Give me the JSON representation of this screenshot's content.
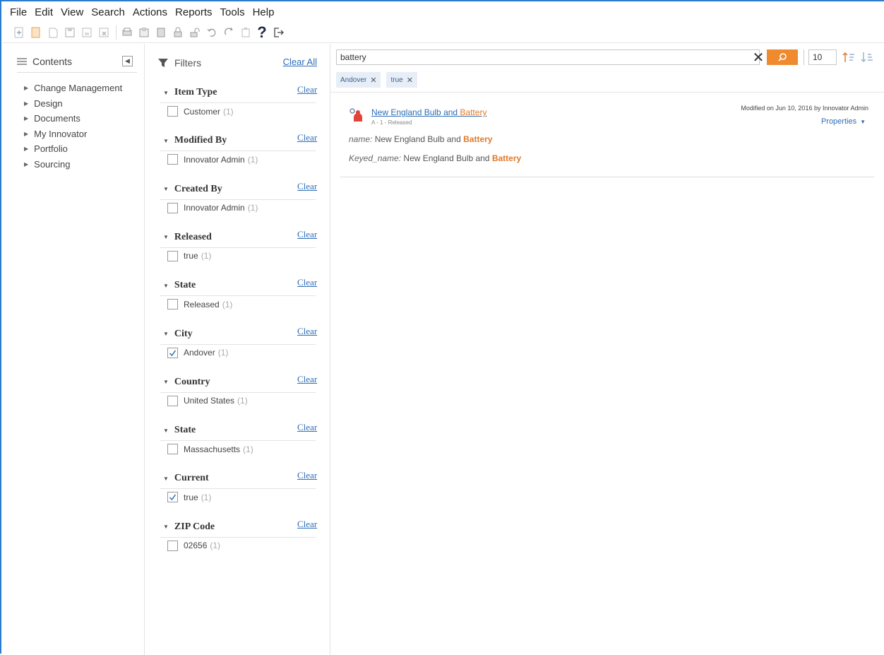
{
  "menu": [
    "File",
    "Edit",
    "View",
    "Search",
    "Actions",
    "Reports",
    "Tools",
    "Help"
  ],
  "toolbar_icons": [
    "new-icon",
    "open-icon",
    "edit-icon",
    "save-icon",
    "save-close-icon",
    "delete-icon",
    "print-icon",
    "copy-icon",
    "paste-icon",
    "lock-icon",
    "unlock-icon",
    "undo-icon",
    "redo-icon",
    "clipboard-icon",
    "help-icon",
    "logout-icon"
  ],
  "toolbar": {
    "help": "?"
  },
  "contents": {
    "title": "Contents",
    "items": [
      "Change Management",
      "Design",
      "Documents",
      "My Innovator",
      "Portfolio",
      "Sourcing"
    ]
  },
  "filters": {
    "title": "Filters",
    "clear_all": "Clear All",
    "clear": "Clear",
    "groups": [
      {
        "title": "Item Type",
        "option": "Customer",
        "count": "(1)",
        "checked": false
      },
      {
        "title": "Modified By",
        "option": "Innovator Admin",
        "count": "(1)",
        "checked": false
      },
      {
        "title": "Created By",
        "option": "Innovator Admin",
        "count": "(1)",
        "checked": false
      },
      {
        "title": "Released",
        "option": "true",
        "count": "(1)",
        "checked": false
      },
      {
        "title": "State",
        "option": "Released",
        "count": "(1)",
        "checked": false
      },
      {
        "title": "City",
        "option": "Andover",
        "count": "(1)",
        "checked": true
      },
      {
        "title": "Country",
        "option": "United States",
        "count": "(1)",
        "checked": false
      },
      {
        "title": "State",
        "option": "Massachusetts",
        "count": "(1)",
        "checked": false
      },
      {
        "title": "Current",
        "option": "true",
        "count": "(1)",
        "checked": true
      },
      {
        "title": "ZIP Code",
        "option": "02656",
        "count": "(1)",
        "checked": false
      }
    ]
  },
  "search": {
    "query": "battery",
    "page_size": "10",
    "chips": [
      "Andover",
      "true"
    ]
  },
  "result": {
    "title_prefix": "New England Bulb and ",
    "title_highlight": "Battery",
    "subtitle": "A - 1 - Released",
    "modified": "Modified on Jun 10, 2016 by Innovator Admin",
    "properties_label": "Properties",
    "props": [
      {
        "key": "name:",
        "value_prefix": " New England Bulb and ",
        "value_highlight": "Battery"
      },
      {
        "key": "Keyed_name:",
        "value_prefix": " New England Bulb and ",
        "value_highlight": "Battery"
      }
    ]
  },
  "colors": {
    "accent": "#ef8a2f",
    "link": "#2f6db5",
    "highlight": "#e07a2a",
    "frame": "#2a7bd1"
  }
}
